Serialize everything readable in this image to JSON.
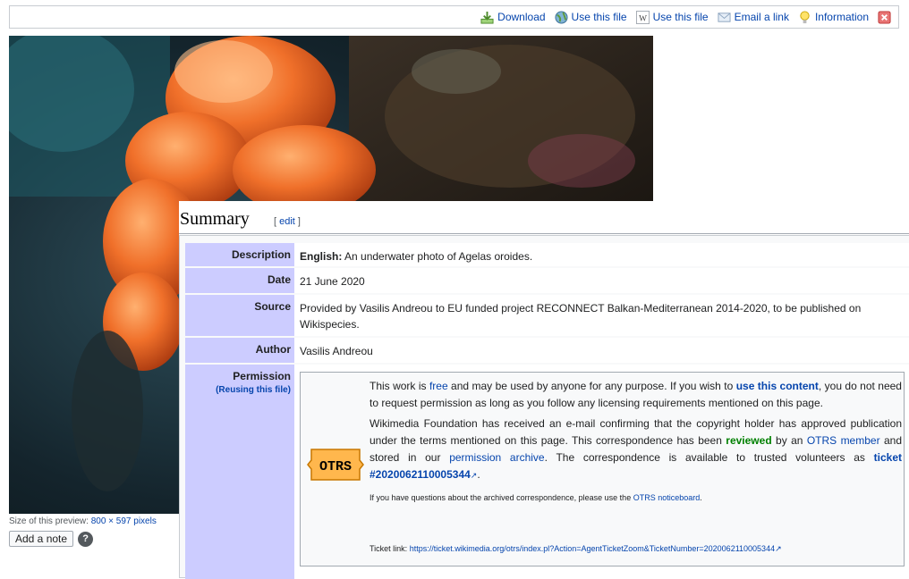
{
  "toolbar": {
    "items": [
      {
        "label": "Download",
        "icon": "download-icon"
      },
      {
        "label": "Use this file",
        "icon": "globe-icon"
      },
      {
        "label": "Use this file",
        "icon": "wikipedia-icon"
      },
      {
        "label": "Email a link",
        "icon": "email-icon"
      },
      {
        "label": "Information",
        "icon": "lightbulb-icon"
      }
    ],
    "close_icon": "close-icon"
  },
  "preview": {
    "caption_prefix": "Size of this preview: ",
    "caption_link": "800 × 597 pixels"
  },
  "add_note_label": "Add a note",
  "help_label": "?",
  "summary": {
    "heading": "Summary",
    "edit_open": "[ ",
    "edit_label": "edit",
    "edit_close": " ]",
    "rows": {
      "description": {
        "label": "Description",
        "lang": "English:",
        "text": " An underwater photo of Agelas oroides."
      },
      "date": {
        "label": "Date",
        "value": "21 June 2020"
      },
      "source": {
        "label": "Source",
        "value": "Provided by Vasilis Andreou to EU funded project RECONNECT Balkan-Mediterranean 2014-2020, to be published on Wikispecies."
      },
      "author": {
        "label": "Author",
        "value": "Vasilis Andreou"
      },
      "permission": {
        "label": "Permission",
        "reuse": "(Reusing this file)",
        "logo_text": "OTRS",
        "p1_a": "This work is ",
        "p1_free": "free",
        "p1_b": " and may be used by anyone for any purpose. If you wish to ",
        "p1_use": "use this content",
        "p1_c": ", you do not need to request permission as long as you follow any licensing requirements mentioned on this page.",
        "p2_a": "Wikimedia Foundation has received an e-mail confirming that the copyright holder has approved publication under the terms mentioned on this page. This correspondence has been ",
        "p2_reviewed": "reviewed",
        "p2_b": " by an ",
        "p2_member": "OTRS member",
        "p2_c": " and stored in our ",
        "p2_archive": "permission archive",
        "p2_d": ". The correspondence is available to trusted volunteers as ",
        "p2_ticket": "ticket #2020062110005344",
        "p2_e": ".",
        "p3_a": "If you have questions about the archived correspondence, please use the ",
        "p3_link": "OTRS noticeboard",
        "p3_b": ".",
        "ticket_prefix": "Ticket link: ",
        "ticket_url": "https://ticket.wikimedia.org/otrs/index.pl?Action=AgentTicketZoom&TicketNumber=2020062110005344"
      }
    }
  },
  "colors": {
    "label_bg": "#ccccff",
    "link": "#0645ad",
    "otrs_logo_fill": "#ffb74d",
    "reviewed": "#008000"
  }
}
